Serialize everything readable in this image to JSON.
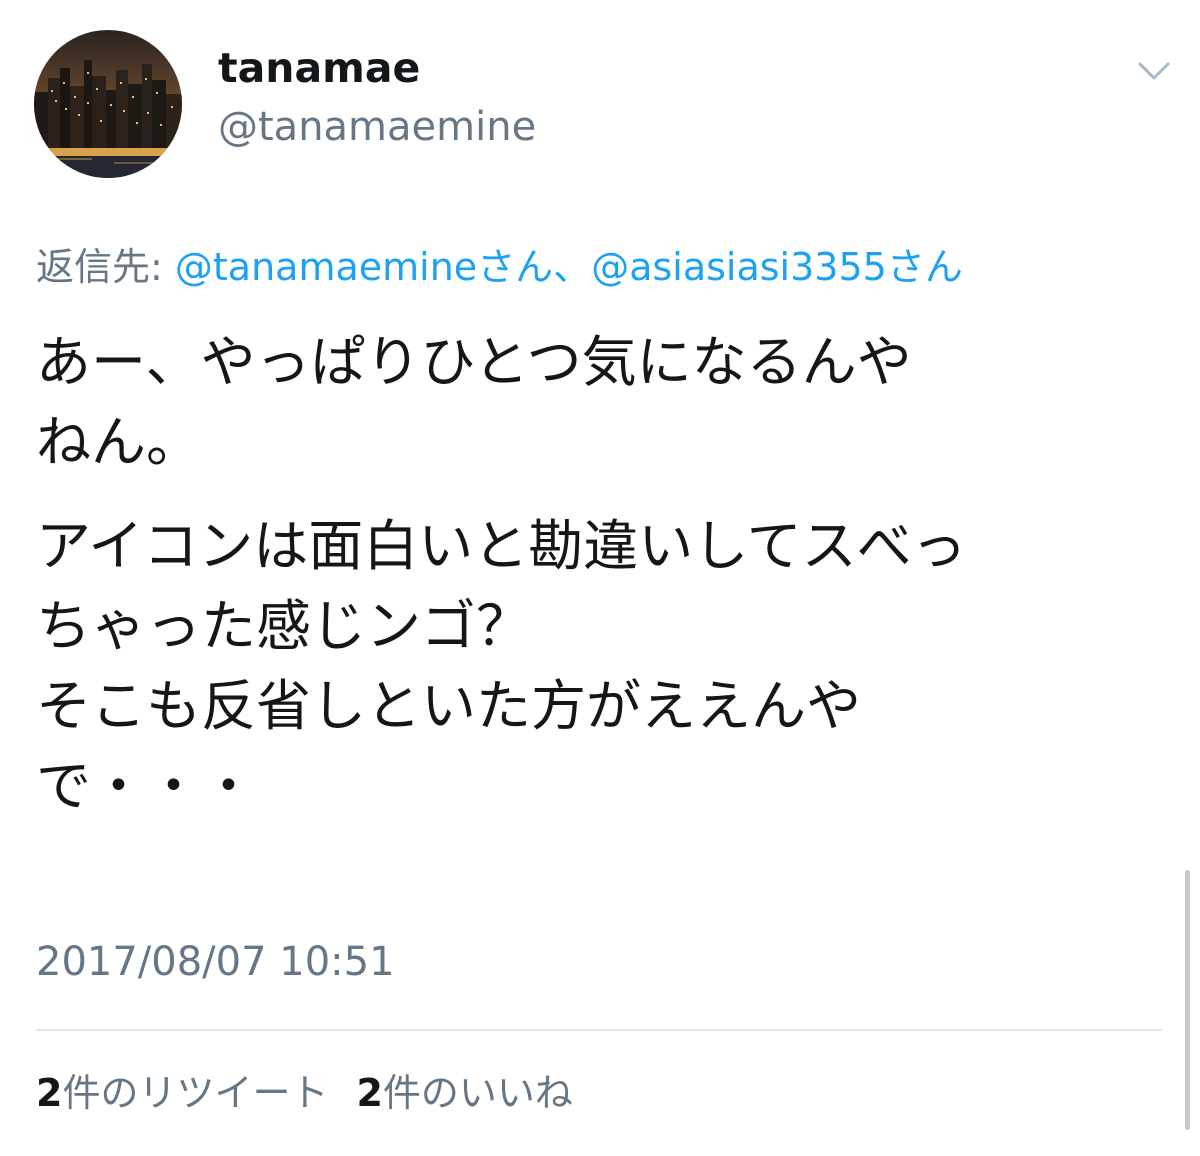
{
  "tweet": {
    "display_name": "tanamae",
    "handle": "@tanamaemine",
    "reply_to": {
      "prefix": "返信先: ",
      "mentions": [
        "@tanamaemineさん",
        "@asiasiasi3355さん"
      ],
      "separator": "、"
    },
    "paragraphs": [
      "あー、やっぱりひとつ気になるんや\nねん。",
      "アイコンは面白いと勘違いしてスべっ\nちゃった感じンゴ？\nそこも反省しといた方がええんや\nで・・・"
    ],
    "timestamp": "2017/08/07 10:51",
    "stats": {
      "retweets_count": "2",
      "retweets_label": "件のリツイート",
      "likes_count": "2",
      "likes_label": "件のいいね"
    }
  },
  "icons": {
    "avatar": "city-night-skyline-avatar",
    "menu": "chevron-down-icon"
  },
  "colors": {
    "text": "#14171a",
    "secondary": "#657786",
    "link": "#1da1f2",
    "divider": "#e1e8ed"
  }
}
